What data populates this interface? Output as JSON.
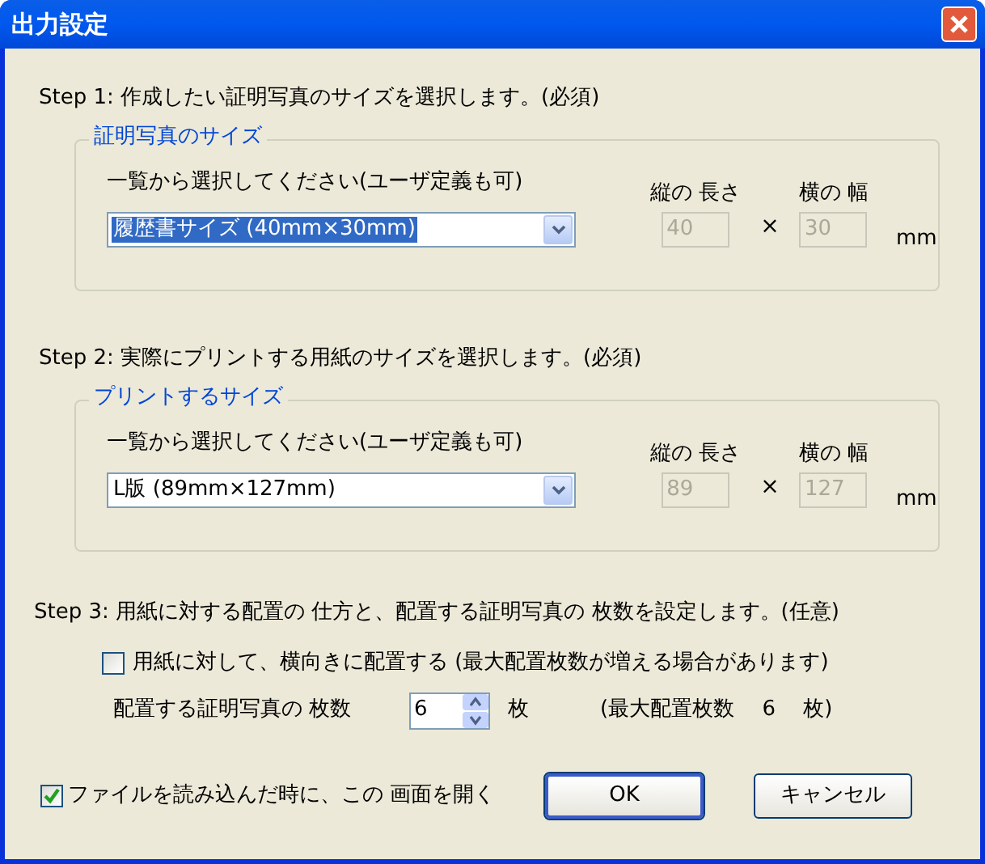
{
  "window": {
    "title": "出力設定"
  },
  "steps": [
    {
      "label": "Step 1:  作成したい証明写真のサイズを選択します。(必須)",
      "group": {
        "title": "証明写真のサイズ",
        "prompt": "一覧から選択してください(ユーザ定義も可)",
        "select": {
          "value": "履歴書サイズ (40mm×30mm)",
          "focused": true
        },
        "height": {
          "label": "縦の 長さ",
          "value": "40",
          "disabled": true
        },
        "times": "×",
        "width": {
          "label": "横の 幅",
          "value": "30",
          "disabled": true
        },
        "unit": "mm"
      }
    },
    {
      "label": "Step 2:  実際にプリントする用紙のサイズを選択します。(必須)",
      "group": {
        "title": "プリントするサイズ",
        "prompt": "一覧から選択してください(ユーザ定義も可)",
        "select": {
          "value": "L版 (89mm×127mm)",
          "focused": false
        },
        "height": {
          "label": "縦の 長さ",
          "value": "89",
          "disabled": true
        },
        "times": "×",
        "width": {
          "label": "横の 幅",
          "value": "127",
          "disabled": true
        },
        "unit": "mm"
      }
    }
  ],
  "step3": {
    "label": "Step 3:  用紙に対する配置の 仕方と、配置する証明写真の 枚数を設定します。(任意)",
    "landscape": {
      "label": "用紙に対して、横向きに配置する  (最大配置枚数が増える場合があります)",
      "checked": false
    },
    "count": {
      "label": "配置する証明写真の 枚数",
      "value": "6",
      "unit": "枚",
      "max_text": "(最大配置枚数　 6　 枚)"
    }
  },
  "open_on_load": {
    "label": "ファイルを読み込んだ時に、この 画面を開く",
    "checked": true
  },
  "buttons": [
    {
      "label": "OK",
      "default": true
    },
    {
      "label": "キャンセル",
      "default": false
    }
  ]
}
